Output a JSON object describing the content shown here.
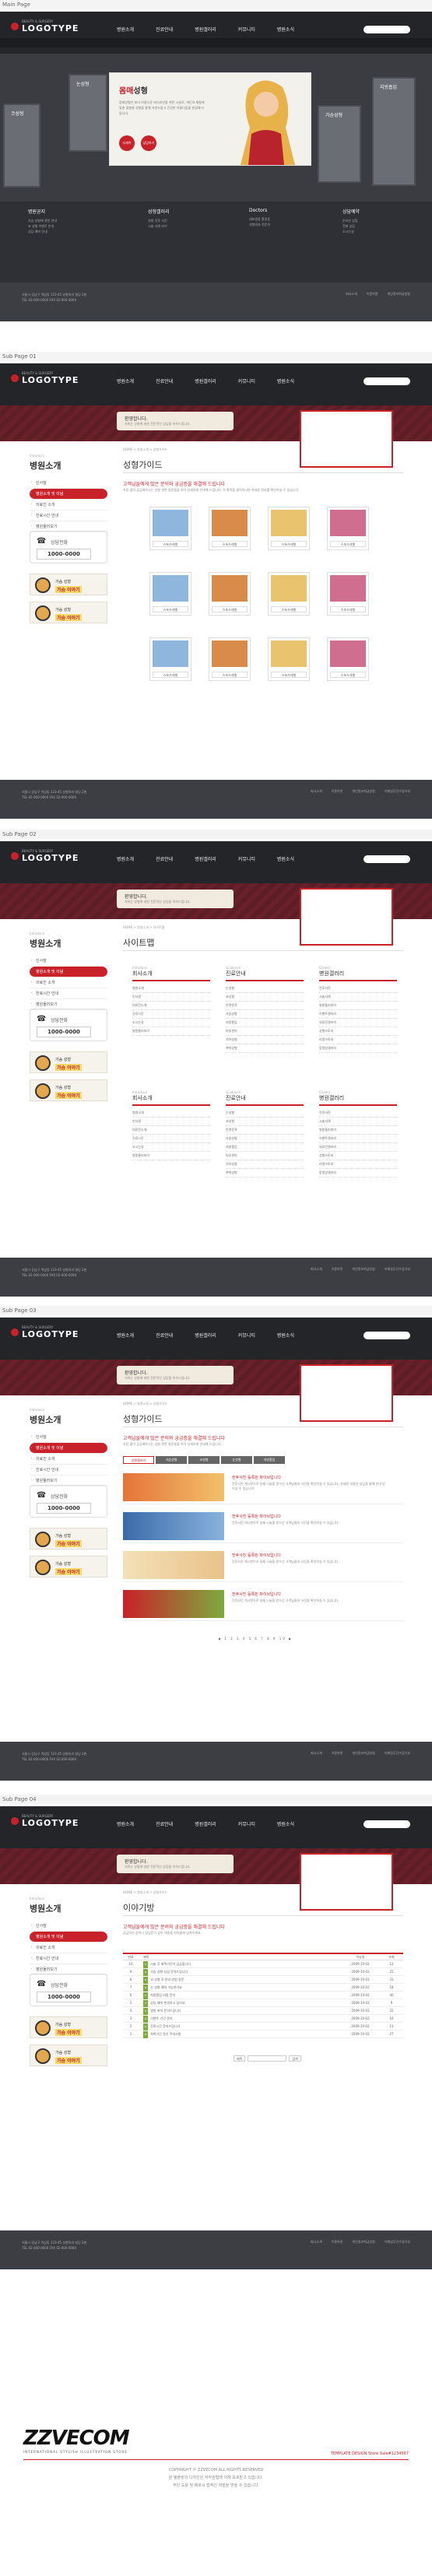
{
  "labels": {
    "main": "Main Page",
    "sub1": "Sub Page 01",
    "sub2": "Sub Page 02",
    "sub3": "Sub Page 03",
    "sub4": "Sub Page 04"
  },
  "header": {
    "logo": "LOGOTYPE",
    "logo_sub": "BEAUTY & SURGERY",
    "gnb": [
      "병원소개",
      "진료안내",
      "병원갤러리",
      "커뮤니티",
      "병원소식"
    ],
    "toplinks": [
      "HOME",
      "LOGIN",
      "JOIN",
      "SITEMAP"
    ]
  },
  "main_visual": {
    "title_a": "몸매",
    "title_b": "성형",
    "desc": "몸매성형은 보다 아름다운 바디라인을 위한 시술로, 개인의 체형에 맞춘 맞춤형 성형을 통해 자연스럽고 건강한 아름다움을 완성해 드립니다.",
    "btn1": "자세히",
    "btn2": "상담하기",
    "cards": [
      "코성형",
      "눈성형",
      "가슴성형",
      "지방흡입"
    ]
  },
  "main_bottom": {
    "box1": {
      "h": "병원공지",
      "items": [
        "가슴 성형에 관한 안내",
        "코 성형 이벤트 안내",
        "상담 예약 안내"
      ]
    },
    "box2": {
      "h": "성형갤러리",
      "items": [
        "성형 전후 사진",
        "시술 사례 보기"
      ]
    },
    "box3": {
      "h": "Doctors",
      "items": [
        "대표원장 홍길동",
        "성형외과 전문의"
      ]
    },
    "box4": {
      "h": "상담예약",
      "items": [
        "온라인 상담",
        "전화 상담",
        "오시는길"
      ]
    }
  },
  "footer": {
    "left": [
      "서울시 강남구 역삼동 123-45 성형외과 빌딩 2층",
      "TEL 02-000-0000  FAX 02-000-0000"
    ],
    "right": [
      "회사소개",
      "이용약관",
      "개인정보취급방침",
      "이메일무단수집거부"
    ]
  },
  "sub_visual": {
    "t1": "환영합니다.",
    "t2": "저희는 성형에 대한 전문적인 상담을 약속드립니다."
  },
  "lnb": {
    "cat": "Introduce",
    "title": "병원소개",
    "items": [
      "인사말",
      "병원소개 및 이념",
      "의료진 소개",
      "진료시간 안내",
      "병원둘러보기"
    ],
    "phone_label": "상담전화",
    "phone": "1000-0000",
    "promo_t1": "가슴 성형",
    "promo_t2": "가슴 이야기"
  },
  "crumb": "HOME > 병원소개 > 성형가이드",
  "sub1": {
    "title": "성형가이드",
    "h": "고객님들에게 많은 문의와 궁금증을 해결해 드립니다",
    "desc": "가장 많이 궁금해하시는 성형 관련 질문들을 모아 상세하게 안내해 드립니다. 각 항목을 클릭하시면 자세한 정보를 확인하실 수 있습니다.",
    "cap": "스포츠레벨",
    "rows": 3,
    "cols": 4
  },
  "sub2": {
    "title": "사이트맵",
    "crumb": "HOME > 병원소개 > 사이트맵",
    "cols": [
      {
        "en": "Introduce",
        "ko": "회사소개",
        "rows": [
          "병원소개",
          "인사말",
          "의료진소개",
          "진료시간",
          "오시는길",
          "병원둘러보기"
        ]
      },
      {
        "en": "Guidance",
        "ko": "진료안내",
        "rows": [
          "눈성형",
          "코성형",
          "안면윤곽",
          "가슴성형",
          "지방흡입",
          "피부관리",
          "치아성형",
          "쁘띠성형"
        ]
      },
      {
        "en": "Gallery",
        "ko": "병원갤러리",
        "rows": [
          "전후사진",
          "시술사례",
          "병원둘러보기",
          "이벤트갤러리",
          "의료진갤러리",
          "성형스토리",
          "리얼스토리",
          "동영상갤러리"
        ]
      }
    ]
  },
  "sub3": {
    "title": "성형가이드",
    "h": "고객님들에게 많은 문의와 궁금증을 해결해 드립니다",
    "desc": "가장 많이 궁금해하시는 성형 관련 질문들을 모아 상세하게 안내해 드립니다.",
    "tabs": [
      "성형갤러리",
      "가슴성형",
      "코성형",
      "눈성형",
      "지방흡입"
    ],
    "items": [
      {
        "t": "전후사진 등록된 파이브입니다",
        "d": "전후사진 게시판으로 실제 시술을 받으신 고객님들의 사진을 확인하실 수 있습니다. 자세한 내용은 상담을 통해 안내 받으실 수 있습니다."
      },
      {
        "t": "전후사진 등록된 파이브입니다",
        "d": "전후사진 게시판으로 실제 시술을 받으신 고객님들의 사진을 확인하실 수 있습니다."
      },
      {
        "t": "전후사진 등록된 파이브입니다",
        "d": "전후사진 게시판으로 실제 시술을 받으신 고객님들의 사진을 확인하실 수 있습니다."
      },
      {
        "t": "전후사진 등록된 파이브입니다",
        "d": "전후사진 게시판으로 실제 시술을 받으신 고객님들의 사진을 확인하실 수 있습니다."
      }
    ],
    "pager": "◀ 1 2 3 4 5 6 7 8 9 10 ▶"
  },
  "sub4": {
    "title": "이야기방",
    "h": "고객님들에게 많은 문의와 궁금증을 해결해 드립니다",
    "desc": "궁금하신 점이나 상담받고 싶은 내용을 자유롭게 남겨주세요.",
    "cols": [
      "번호",
      "제목",
      "작성일",
      "조회"
    ],
    "rows": [
      [
        "10",
        "시술 후 회복기간이 궁금합니다",
        "2009-10-02",
        "12"
      ],
      [
        "9",
        "가슴 성형 상담 문의드립니다",
        "2009-10-02",
        "25"
      ],
      [
        "8",
        "코 성형 후 관리 방법 질문",
        "2009-10-02",
        "31"
      ],
      [
        "7",
        "눈 성형 예약 가능한가요",
        "2009-10-02",
        "18"
      ],
      [
        "6",
        "지방흡입 비용 문의",
        "2009-10-02",
        "40"
      ],
      [
        "5",
        "상담 예약 변경하고 싶어요",
        "2009-10-02",
        "9"
      ],
      [
        "4",
        "병원 위치 문의드립니다",
        "2009-10-02",
        "22"
      ],
      [
        "3",
        "이벤트 기간 문의",
        "2009-10-02",
        "16"
      ],
      [
        "2",
        "진료시간 문의드립니다",
        "2009-10-02",
        "11"
      ],
      [
        "1",
        "회복기간 동안 주의사항",
        "2009-10-02",
        "27"
      ]
    ],
    "search_sel": "제목",
    "search_btn": "검색"
  },
  "brand": {
    "name": "ZZVECOM",
    "tag": "INTERNATIONAL STYLISH ILLUSTRATION STORE",
    "right": "TEMPLATE DESIGN Store  Sale#1234567",
    "copy1": "COPYRIGHT © ZZVECOM ALL RIGHTS RESERVED",
    "copy2": "본 템플릿의 디자인은 저작권법에 의해 보호받고 있습니다.",
    "copy3": "무단 도용 및 배포시 법적인 처벌을 받을 수 있습니다."
  }
}
